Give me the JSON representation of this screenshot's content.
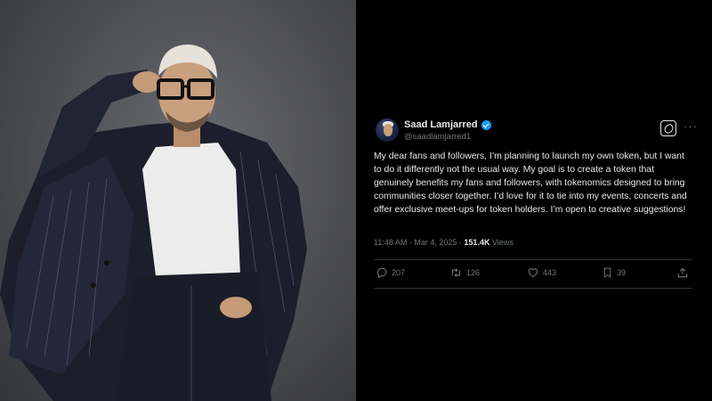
{
  "tweet": {
    "author_name": "Saad Lamjarred",
    "handle": "@saadlamjarred1",
    "text": "My dear fans and followers, I’m planning to launch my own token, but I want to do it differently not the usual way. My goal is to create a token that genuinely benefits my fans and followers, with tokenomics designed to bring communities closer together. I’d love for it to tie into my events, concerts and offer exclusive meet-ups for token holders. I’m open to creative suggestions!",
    "time": "11:48 AM",
    "date": "Mar 4, 2025",
    "views_count": "151.4K",
    "views_label": "Views",
    "more_label": "···",
    "replies": "207",
    "retweets": "126",
    "likes": "443",
    "bookmarks": "39"
  },
  "colors": {
    "background": "#000000",
    "text_primary": "#e7e9ea",
    "text_secondary": "#71767b",
    "verified": "#1d9bf0",
    "divider": "#2f3336"
  },
  "icons": [
    "grok-icon",
    "more-icon",
    "verified-icon",
    "reply-icon",
    "retweet-icon",
    "like-icon",
    "bookmark-icon",
    "share-icon"
  ]
}
